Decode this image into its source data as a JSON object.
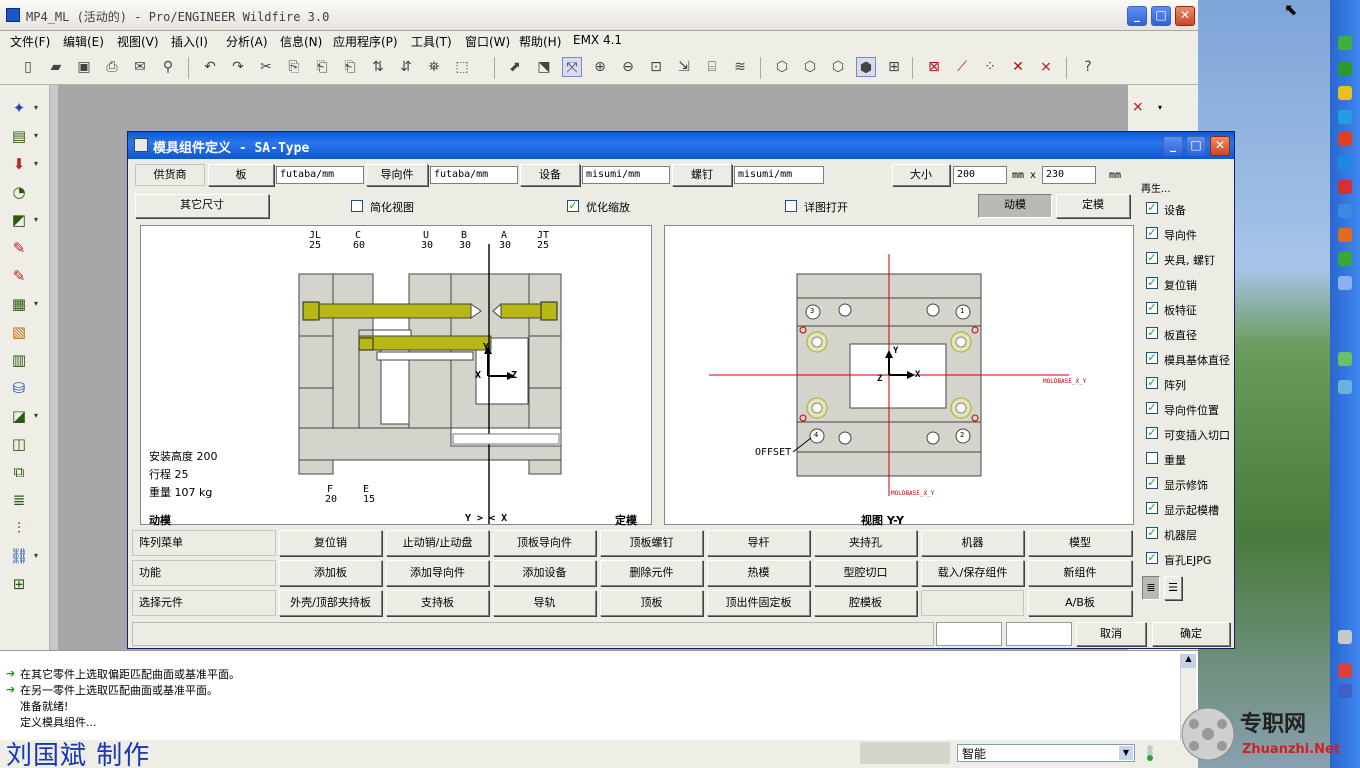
{
  "window": {
    "title": "MP4_ML (活动的) - Pro/ENGINEER Wildfire 3.0",
    "minimize": "_",
    "maximize": "□",
    "close": "✕"
  },
  "menu": [
    "文件(F)",
    "编辑(E)",
    "视图(V)",
    "插入(I)",
    "分析(A)",
    "信息(N)",
    "应用程序(P)",
    "工具(T)",
    "窗口(W)",
    "帮助(H)",
    "EMX 4.1"
  ],
  "dialog": {
    "title": "模具组件定义 - SA-Type",
    "row1": {
      "supplier_label": "供货商",
      "plate_button": "板",
      "plate_value": "futaba/mm",
      "guide_button": "导向件",
      "guide_value": "futaba/mm",
      "equipment_button": "设备",
      "equipment_value": "misumi/mm",
      "screw_button": "螺钉",
      "screw_value": "misumi/mm",
      "size_button": "大小",
      "size_w": "200",
      "size_x_label": "mm x",
      "size_h": "230",
      "size_unit": "mm"
    },
    "row2": {
      "other_size_button": "其它尺寸",
      "simplified_view_label": "简化视图",
      "optimized_zoom_label": "优化缩放",
      "detail_open_label": "详图打开",
      "moving_button": "动模",
      "fixed_button": "定模"
    },
    "left_view": {
      "col_labels": [
        {
          "name": "JL",
          "val": "25"
        },
        {
          "name": "C",
          "val": "60"
        },
        {
          "name": "U",
          "val": "30"
        },
        {
          "name": "B",
          "val": "30"
        },
        {
          "name": "A",
          "val": "30"
        },
        {
          "name": "JT",
          "val": "25"
        }
      ],
      "bottom_labels": [
        {
          "name": "F",
          "val": "20"
        },
        {
          "name": "E",
          "val": "15"
        }
      ],
      "install_height": "安装高度 200",
      "stroke": "行程 25",
      "weight": "重量 107 kg",
      "moving_label": "动模",
      "axis_label": "Y > < X",
      "fixed_label": "定模",
      "axis_y": "Y",
      "axis_x": "X",
      "axis_z": "Z"
    },
    "right_view": {
      "view_label": "视图 Y-Y",
      "offset_label": "OFFSET",
      "datum_label_1": "MOLDBASE_X_Y",
      "datum_label_2": "MOLDBASE_X_Y",
      "pins": [
        "3",
        "1",
        "4",
        "2"
      ],
      "axis_y": "Y",
      "axis_x": "X",
      "axis_z": "Z"
    },
    "side_header": "再生...",
    "side_options": [
      {
        "label": "设备",
        "checked": true
      },
      {
        "label": "导向件",
        "checked": true
      },
      {
        "label": "夹具, 螺钉",
        "checked": true
      },
      {
        "label": "复位销",
        "checked": true
      },
      {
        "label": "板特征",
        "checked": true
      },
      {
        "label": "板直径",
        "checked": true
      },
      {
        "label": "模具基体直径",
        "checked": true
      },
      {
        "label": "阵列",
        "checked": true
      },
      {
        "label": "导向件位置",
        "checked": true
      },
      {
        "label": "可变插入切口",
        "checked": true
      },
      {
        "label": "重量",
        "checked": false
      },
      {
        "label": "显示修饰",
        "checked": true
      },
      {
        "label": "显示起模槽",
        "checked": true
      },
      {
        "label": "机器层",
        "checked": true
      },
      {
        "label": "盲孔EJPG",
        "checked": true
      }
    ],
    "menu_rows": [
      {
        "label": "阵列菜单",
        "items": [
          "复位销",
          "止动销/止动盘",
          "顶板导向件",
          "顶板螺钉",
          "导杆",
          "夹持孔",
          "机器",
          "模型"
        ]
      },
      {
        "label": "功能",
        "items": [
          "添加板",
          "添加导向件",
          "添加设备",
          "删除元件",
          "热模",
          "型腔切口",
          "载入/保存组件",
          "新组件"
        ]
      },
      {
        "label": "选择元件",
        "items": [
          "外壳/顶部夹持板",
          "支持板",
          "导轨",
          "顶板",
          "顶出件固定板",
          "腔模板",
          "",
          "A/B板"
        ]
      }
    ],
    "cancel_button": "取消",
    "ok_button": "确定"
  },
  "messages": [
    "在其它零件上选取偏距匹配曲面或基准平面。",
    "在另一零件上选取匹配曲面或基准平面。",
    "准备就绪!",
    "定义模具组件..."
  ],
  "watermark": "刘国斌 制作",
  "status_select": "智能",
  "zhuanzhi": {
    "cn": "专职网",
    "url": "Zhuanzhi.Net"
  },
  "colors": {
    "accent": "#0a5ad8",
    "plate_yellow": "#b8b814",
    "datum_red": "#c80000",
    "watermark_blue": "#1838b8"
  }
}
